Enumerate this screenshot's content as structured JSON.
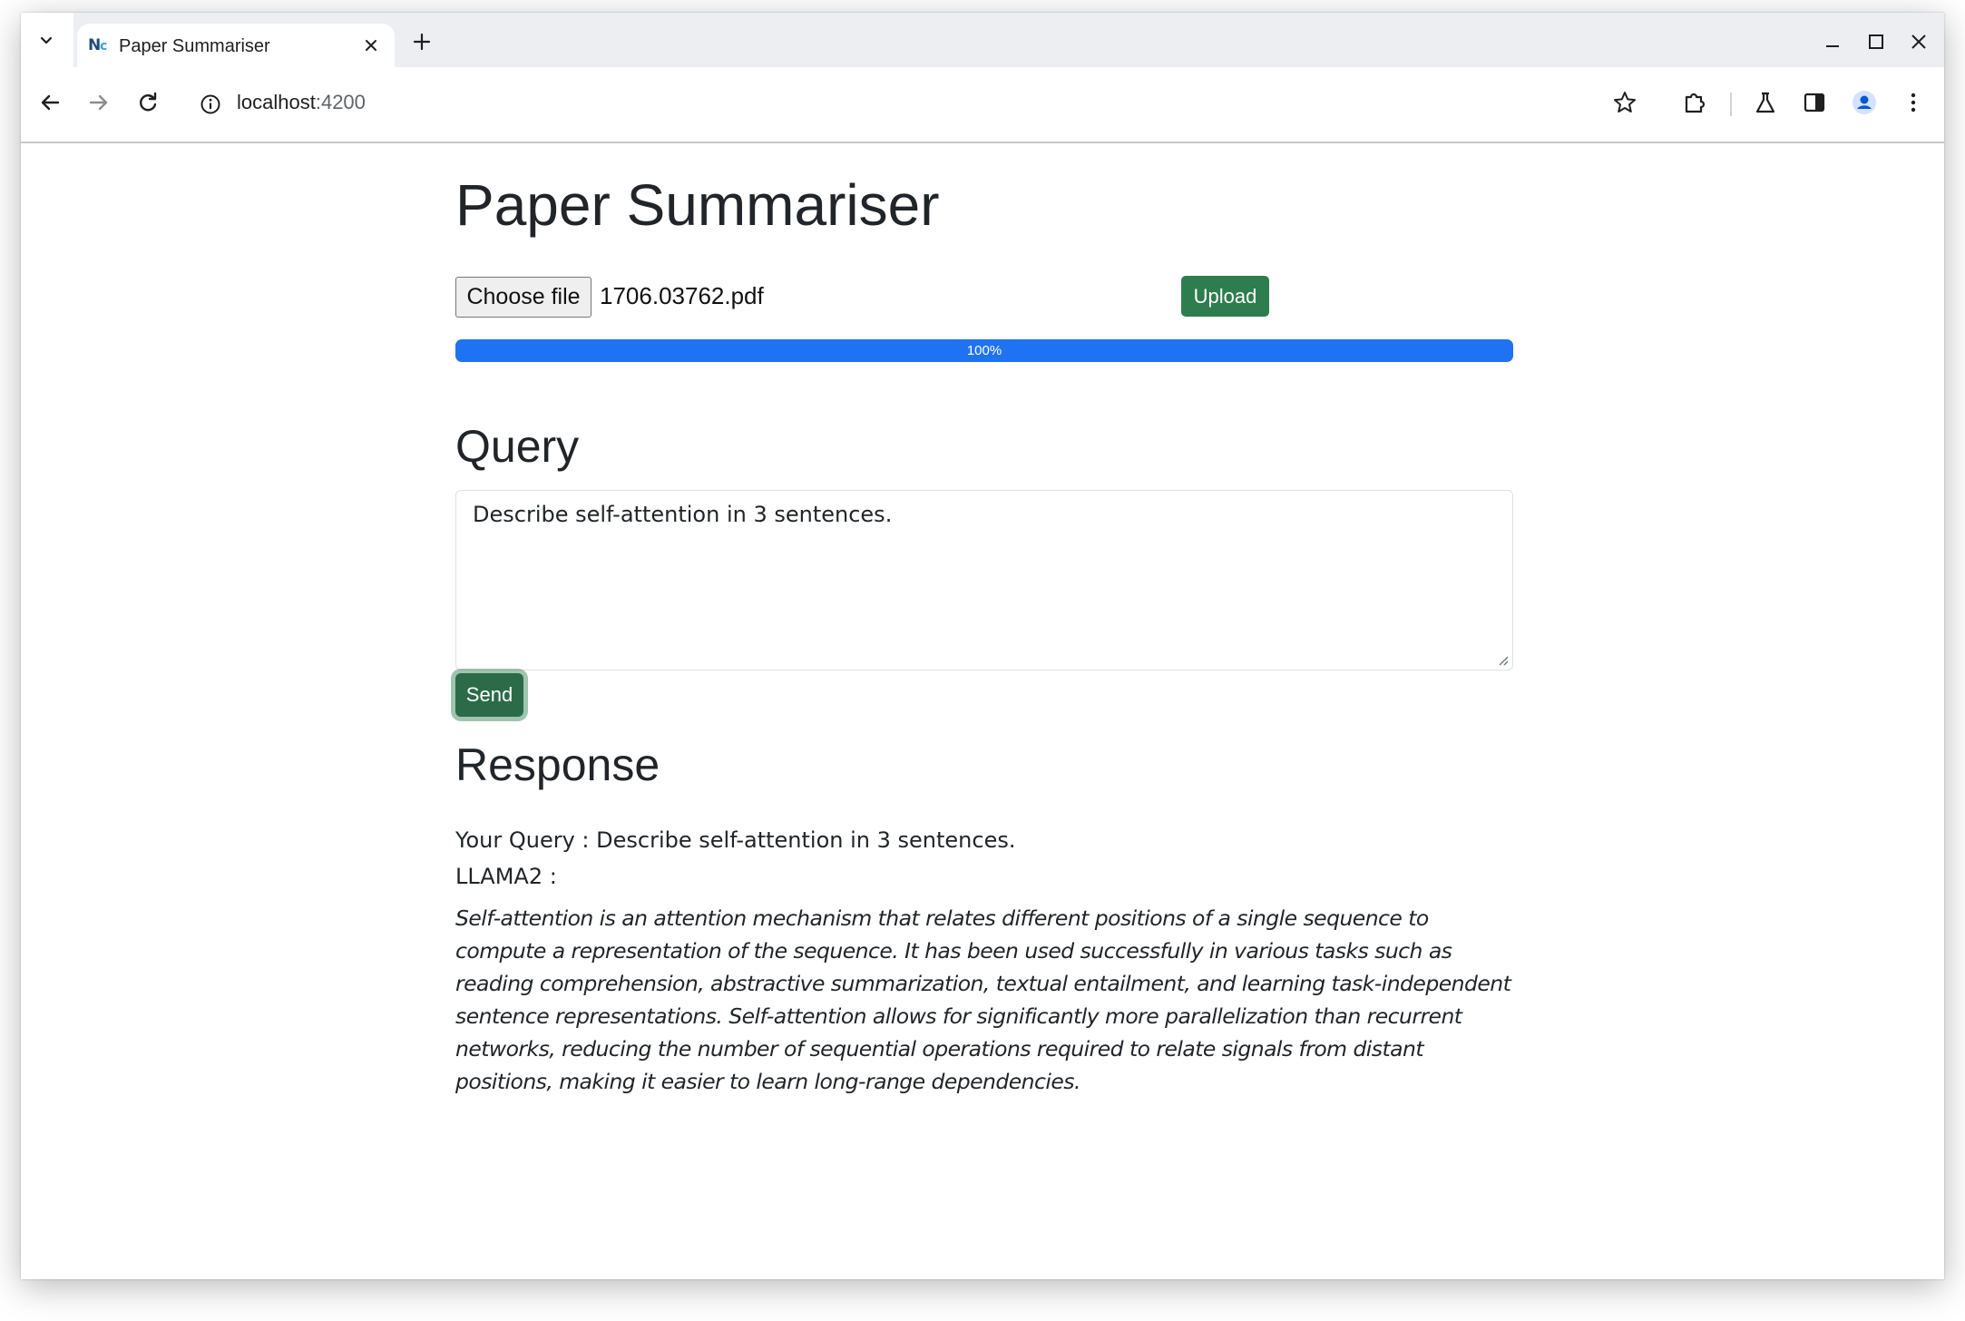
{
  "browser": {
    "tab": {
      "title": "Paper Summariser",
      "favicon": "Nc"
    },
    "icons": {
      "tab_search": "chevron-down-icon",
      "close_tab": "close-icon",
      "new_tab": "plus-icon",
      "minimize": "minimize-icon",
      "maximize": "maximize-icon",
      "close_window": "close-icon",
      "back": "arrow-left-icon",
      "forward": "arrow-right-icon",
      "reload": "reload-icon",
      "site_info": "info-icon",
      "bookmark": "star-icon",
      "extensions": "puzzle-icon",
      "labs": "flask-icon",
      "side_panel": "side-panel-icon",
      "profile": "avatar-icon",
      "menu": "kebab-menu-icon"
    },
    "address": {
      "host": "localhost",
      "port": ":4200"
    }
  },
  "page": {
    "title": "Paper Summariser",
    "upload": {
      "choose_label": "Choose file",
      "file_name": "1706.03762.pdf",
      "upload_label": "Upload",
      "progress_label": "100%",
      "progress_value": 100
    },
    "query": {
      "heading": "Query",
      "text": "Describe self-attention in 3 sentences.",
      "send_label": "Send"
    },
    "response": {
      "heading": "Response",
      "your_query": "Your Query : Describe self-attention in 3 sentences.",
      "model_label": "LLAMA2 :",
      "answer": "Self-attention is an attention mechanism that relates different positions of a single sequence to compute a representation of the sequence. It has been used successfully in various tasks such as reading comprehension, abstractive summarization, textual entailment, and learning task-independent sentence representations. Self-attention allows for significantly more parallelization than recurrent networks, reducing the number of sequential operations required to relate signals from distant positions, making it easier to learn long-range dependencies."
    }
  },
  "colors": {
    "accent_green": "#2e7d4f",
    "progress_blue": "#1f73f2",
    "text": "#212529"
  }
}
